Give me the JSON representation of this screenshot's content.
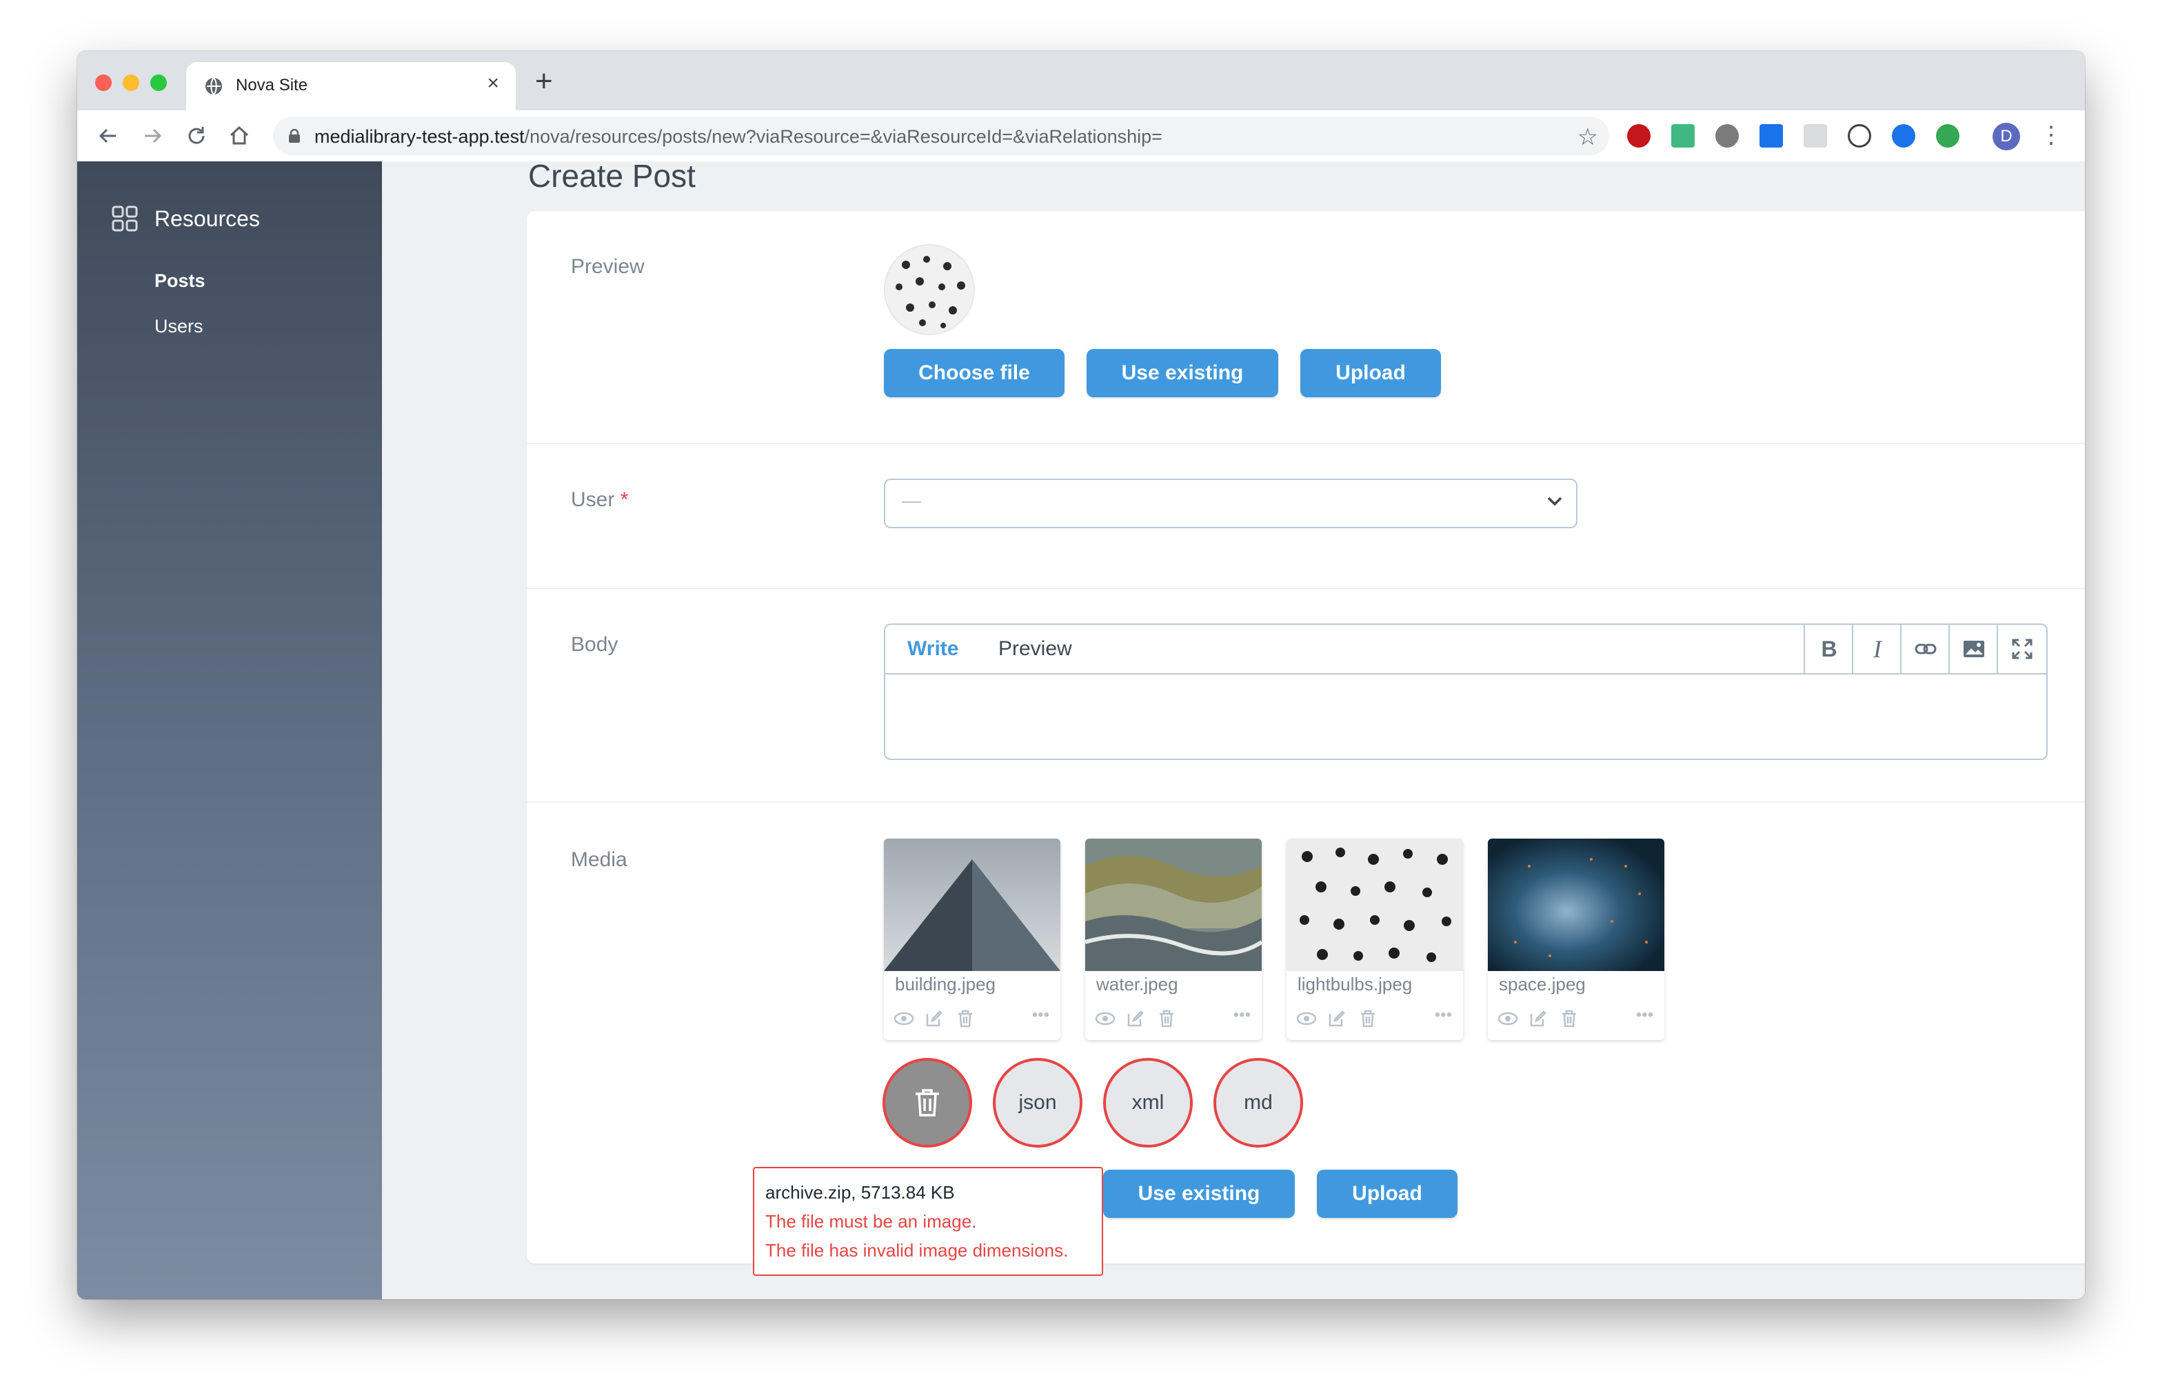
{
  "browser": {
    "tab_title": "Nova Site",
    "url_host": "medialibrary-test-app.test",
    "url_path": "/nova/resources/posts/new?viaResource=&viaResourceId=&viaRelationship=",
    "profile_initial": "D"
  },
  "sidebar": {
    "heading": "Resources",
    "items": [
      {
        "label": "Posts",
        "active": true
      },
      {
        "label": "Users",
        "active": false
      }
    ]
  },
  "page": {
    "title": "Create Post"
  },
  "form": {
    "preview": {
      "label": "Preview",
      "buttons": {
        "choose": "Choose file",
        "existing": "Use existing",
        "upload": "Upload"
      }
    },
    "user": {
      "label": "User",
      "required_mark": "*",
      "selected_value": "—"
    },
    "body": {
      "label": "Body",
      "tabs": {
        "write": "Write",
        "preview": "Preview"
      },
      "tools": [
        "bold-icon",
        "italic-icon",
        "link-icon",
        "image-icon",
        "fullscreen-icon"
      ]
    },
    "media": {
      "label": "Media",
      "files": [
        {
          "name": "building.jpeg"
        },
        {
          "name": "water.jpeg"
        },
        {
          "name": "lightbulbs.jpeg"
        },
        {
          "name": "space.jpeg"
        }
      ],
      "pending": [
        "json",
        "xml",
        "md"
      ],
      "buttons": {
        "existing": "Use existing",
        "upload": "Upload"
      },
      "error": {
        "file": "archive.zip, 5713.84 KB",
        "messages": [
          "The file must be an image.",
          "The file has invalid image dimensions."
        ]
      }
    }
  },
  "colors": {
    "primary": "#4099de",
    "danger": "#e74444",
    "sidebar_top": "#3f4a5a",
    "sidebar_bottom": "#7d8ca2"
  }
}
